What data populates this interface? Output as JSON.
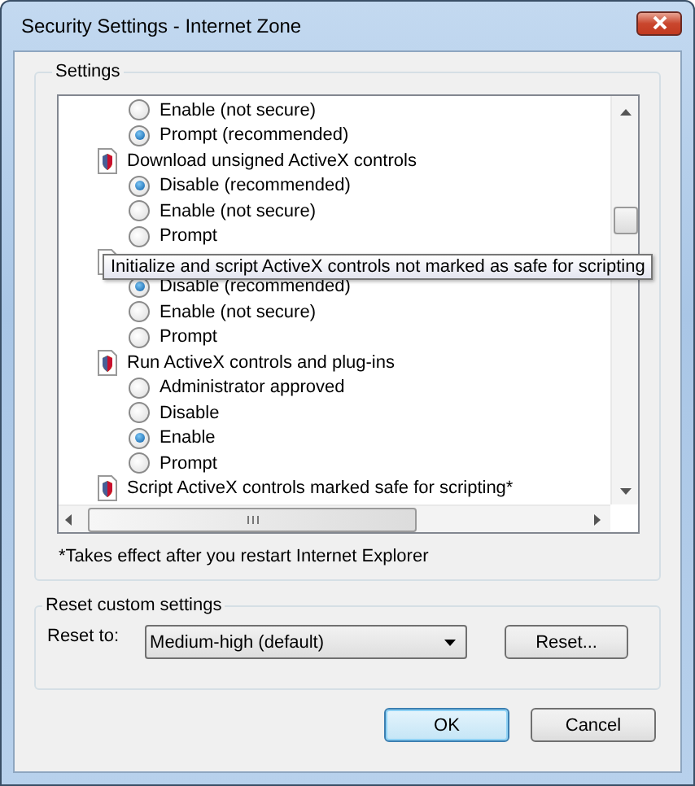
{
  "window": {
    "title": "Security Settings - Internet Zone"
  },
  "settings": {
    "label": "Settings",
    "items": [
      {
        "kind": "option",
        "label": "Enable (not secure)",
        "selected": false
      },
      {
        "kind": "option",
        "label": "Prompt (recommended)",
        "selected": true
      },
      {
        "kind": "heading",
        "label": "Download unsigned ActiveX controls"
      },
      {
        "kind": "option",
        "label": "Disable (recommended)",
        "selected": true
      },
      {
        "kind": "option",
        "label": "Enable (not secure)",
        "selected": false
      },
      {
        "kind": "option",
        "label": "Prompt",
        "selected": false
      },
      {
        "kind": "heading"
      },
      {
        "kind": "option",
        "label": "Disable (recommended)",
        "selected": true
      },
      {
        "kind": "option",
        "label": "Enable (not secure)",
        "selected": false
      },
      {
        "kind": "option",
        "label": "Prompt",
        "selected": false
      },
      {
        "kind": "heading",
        "label": "Run ActiveX controls and plug-ins"
      },
      {
        "kind": "option",
        "label": "Administrator approved",
        "selected": false
      },
      {
        "kind": "option",
        "label": "Disable",
        "selected": false
      },
      {
        "kind": "option",
        "label": "Enable",
        "selected": true
      },
      {
        "kind": "option",
        "label": "Prompt",
        "selected": false
      },
      {
        "kind": "heading",
        "label": "Script ActiveX controls marked safe for scripting*"
      }
    ],
    "tooltip": "Initialize and script ActiveX controls not marked as safe for scripting",
    "footnote": "*Takes effect after you restart Internet Explorer"
  },
  "reset": {
    "label": "Reset custom settings",
    "reset_to_label": "Reset to:",
    "value": "Medium-high (default)",
    "button": "Reset..."
  },
  "buttons": [
    {
      "label": "OK",
      "default": true
    },
    {
      "label": "Cancel",
      "default": false
    }
  ]
}
